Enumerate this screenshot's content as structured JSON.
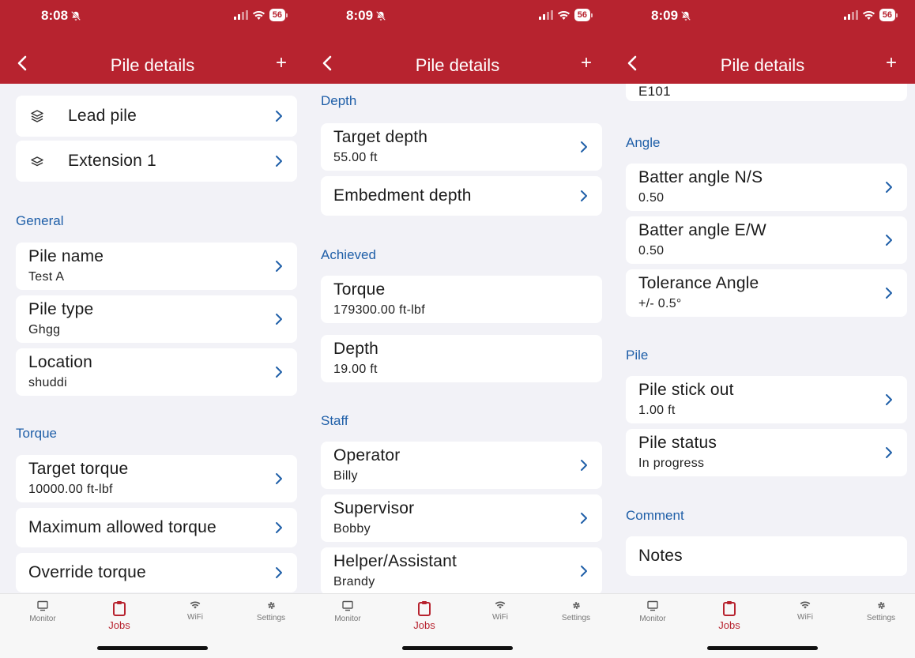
{
  "colors": {
    "header": "#b7232f",
    "section": "#1f5fa8",
    "background": "#f2f2f7"
  },
  "tabbar": [
    {
      "label": "Monitor",
      "icon": "monitor-icon"
    },
    {
      "label": "Jobs",
      "icon": "clipboard-icon"
    },
    {
      "label": "WiFi",
      "icon": "wifi-icon"
    },
    {
      "label": "Settings",
      "icon": "gear-icon"
    }
  ],
  "screens": [
    {
      "time": "8:08",
      "battery": "56",
      "title": "Pile details",
      "components": {
        "lead": "Lead pile",
        "ext": "Extension 1"
      },
      "general": {
        "header": "General",
        "pile_name": {
          "label": "Pile name",
          "value": "Test A"
        },
        "pile_type": {
          "label": "Pile type",
          "value": "Ghgg"
        },
        "location": {
          "label": "Location",
          "value": "shuddi"
        }
      },
      "torque": {
        "header": "Torque",
        "target": {
          "label": "Target torque",
          "value": "10000.00 ft-lbf"
        },
        "max_allowed": "Maximum allowed torque",
        "override": "Override torque"
      }
    },
    {
      "time": "8:09",
      "battery": "56",
      "title": "Pile details",
      "depth": {
        "header": "Depth",
        "target": {
          "label": "Target depth",
          "value": "55.00 ft"
        },
        "embedment": "Embedment depth"
      },
      "achieved": {
        "header": "Achieved",
        "torque": {
          "label": "Torque",
          "value": "179300.00 ft-lbf"
        },
        "depth": {
          "label": "Depth",
          "value": "19.00 ft"
        }
      },
      "staff": {
        "header": "Staff",
        "operator": {
          "label": "Operator",
          "value": "Billy"
        },
        "supervisor": {
          "label": "Supervisor",
          "value": "Bobby"
        },
        "helper": {
          "label": "Helper/Assistant",
          "value": "Brandy"
        }
      }
    },
    {
      "time": "8:09",
      "battery": "56",
      "title": "Pile details",
      "top_value": "E101",
      "angle": {
        "header": "Angle",
        "ns": {
          "label": "Batter angle N/S",
          "value": "0.50"
        },
        "ew": {
          "label": "Batter angle E/W",
          "value": "0.50"
        },
        "tolerance": {
          "label": "Tolerance Angle",
          "value": "+/- 0.5°"
        }
      },
      "pile": {
        "header": "Pile",
        "stickout": {
          "label": "Pile stick out",
          "value": "1.00 ft"
        },
        "status": {
          "label": "Pile status",
          "value": "In progress"
        }
      },
      "comment": {
        "header": "Comment",
        "notes": "Notes"
      }
    }
  ]
}
